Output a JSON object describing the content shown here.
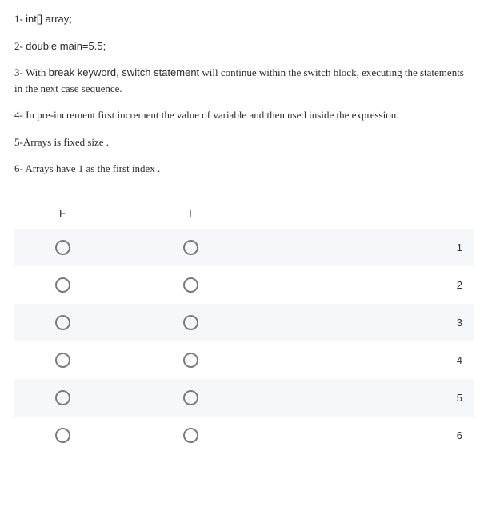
{
  "statements": [
    {
      "prefix": "1- ",
      "code": "int[] array;",
      "rest": ""
    },
    {
      "prefix": "2- ",
      "code": "double main=5.5;",
      "rest": ""
    },
    {
      "prefix": "3- With ",
      "code": "break keyword, switch statement",
      "rest": " will continue within the switch block, executing the statements in the next case sequence."
    },
    {
      "prefix": "4- In pre-increment first increment the value of variable and then used inside the expression.",
      "code": "",
      "rest": ""
    },
    {
      "prefix": "5-Arrays is fixed size .",
      "code": "",
      "rest": ""
    },
    {
      "prefix": "6- Arrays have 1 as the first index .",
      "code": "",
      "rest": ""
    }
  ],
  "headers": {
    "false": "F",
    "true": "T"
  },
  "rows": [
    {
      "num": "1"
    },
    {
      "num": "2"
    },
    {
      "num": "3"
    },
    {
      "num": "4"
    },
    {
      "num": "5"
    },
    {
      "num": "6"
    }
  ]
}
